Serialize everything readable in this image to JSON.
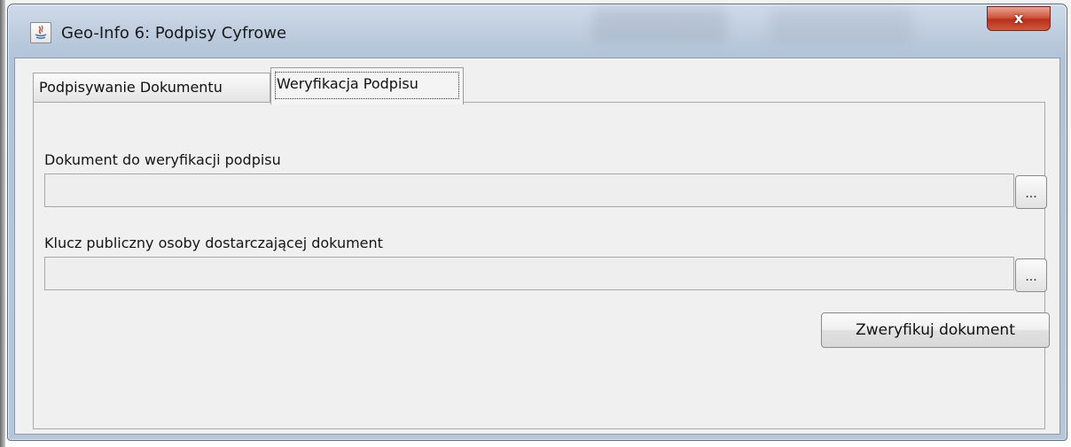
{
  "window": {
    "title": "Geo-Info 6: Podpisy Cyfrowe",
    "icon": "java-icon",
    "close_label": "x"
  },
  "tabs": [
    {
      "label": "Podpisywanie Dokumentu",
      "active": false
    },
    {
      "label": "Weryfikacja Podpisu",
      "active": true
    }
  ],
  "form": {
    "document_label": "Dokument do weryfikacji podpisu",
    "document_value": "",
    "document_browse": "...",
    "key_label": "Klucz publiczny osoby dostarczającej dokument",
    "key_value": "",
    "key_browse": "...",
    "verify_button": "Zweryfikuj dokument"
  }
}
